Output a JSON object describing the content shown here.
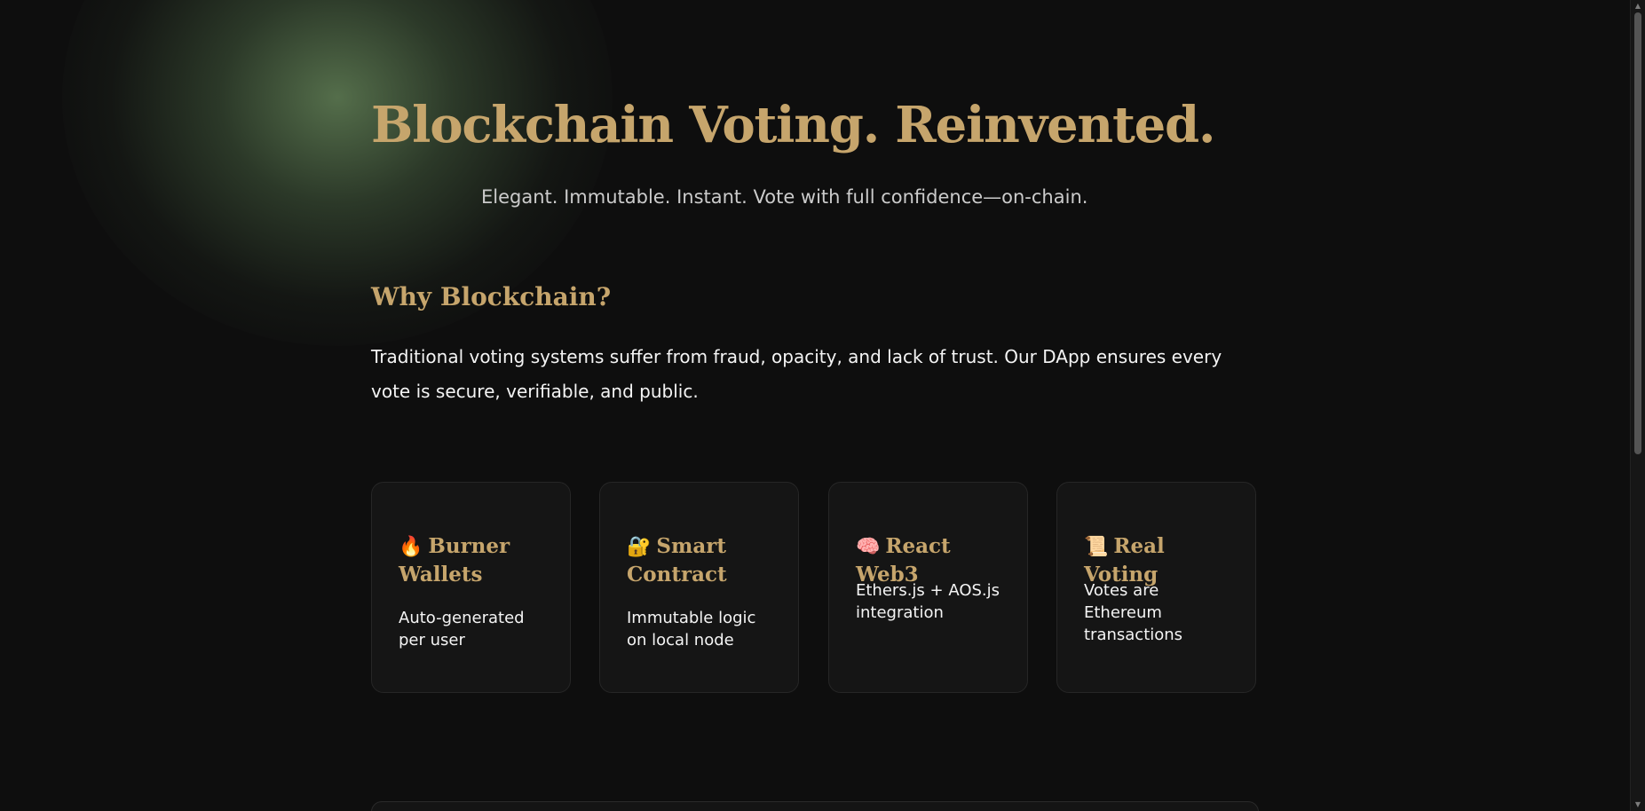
{
  "hero": {
    "title": "Blockchain Voting. Reinvented.",
    "subtitle": "Elegant. Immutable. Instant. Vote with full confidence—on-chain."
  },
  "why": {
    "heading": "Why Blockchain?",
    "text": "Traditional voting systems suffer from fraud, opacity, and lack of trust. Our DApp ensures every vote is secure, verifiable, and public."
  },
  "cards": [
    {
      "icon_name": "fire-icon",
      "icon": "🔥",
      "title": "Burner Wallets",
      "description": "Auto-generated per user"
    },
    {
      "icon_name": "locked-with-key-icon",
      "icon": "🔐",
      "title": "Smart Contract",
      "description": "Immutable logic on local node"
    },
    {
      "icon_name": "brain-icon",
      "icon": "🧠",
      "title": "React Web3",
      "description": "Ethers.js + AOS.js integration"
    },
    {
      "icon_name": "scroll-icon",
      "icon": "📜",
      "title": "Real Voting",
      "description": "Votes are Ethereum transactions"
    }
  ],
  "colors": {
    "background": "#0e0e0e",
    "accent_gold": "#c6a56c",
    "glow_green": "#58734e",
    "card_background": "#151515",
    "card_border": "#262626"
  }
}
